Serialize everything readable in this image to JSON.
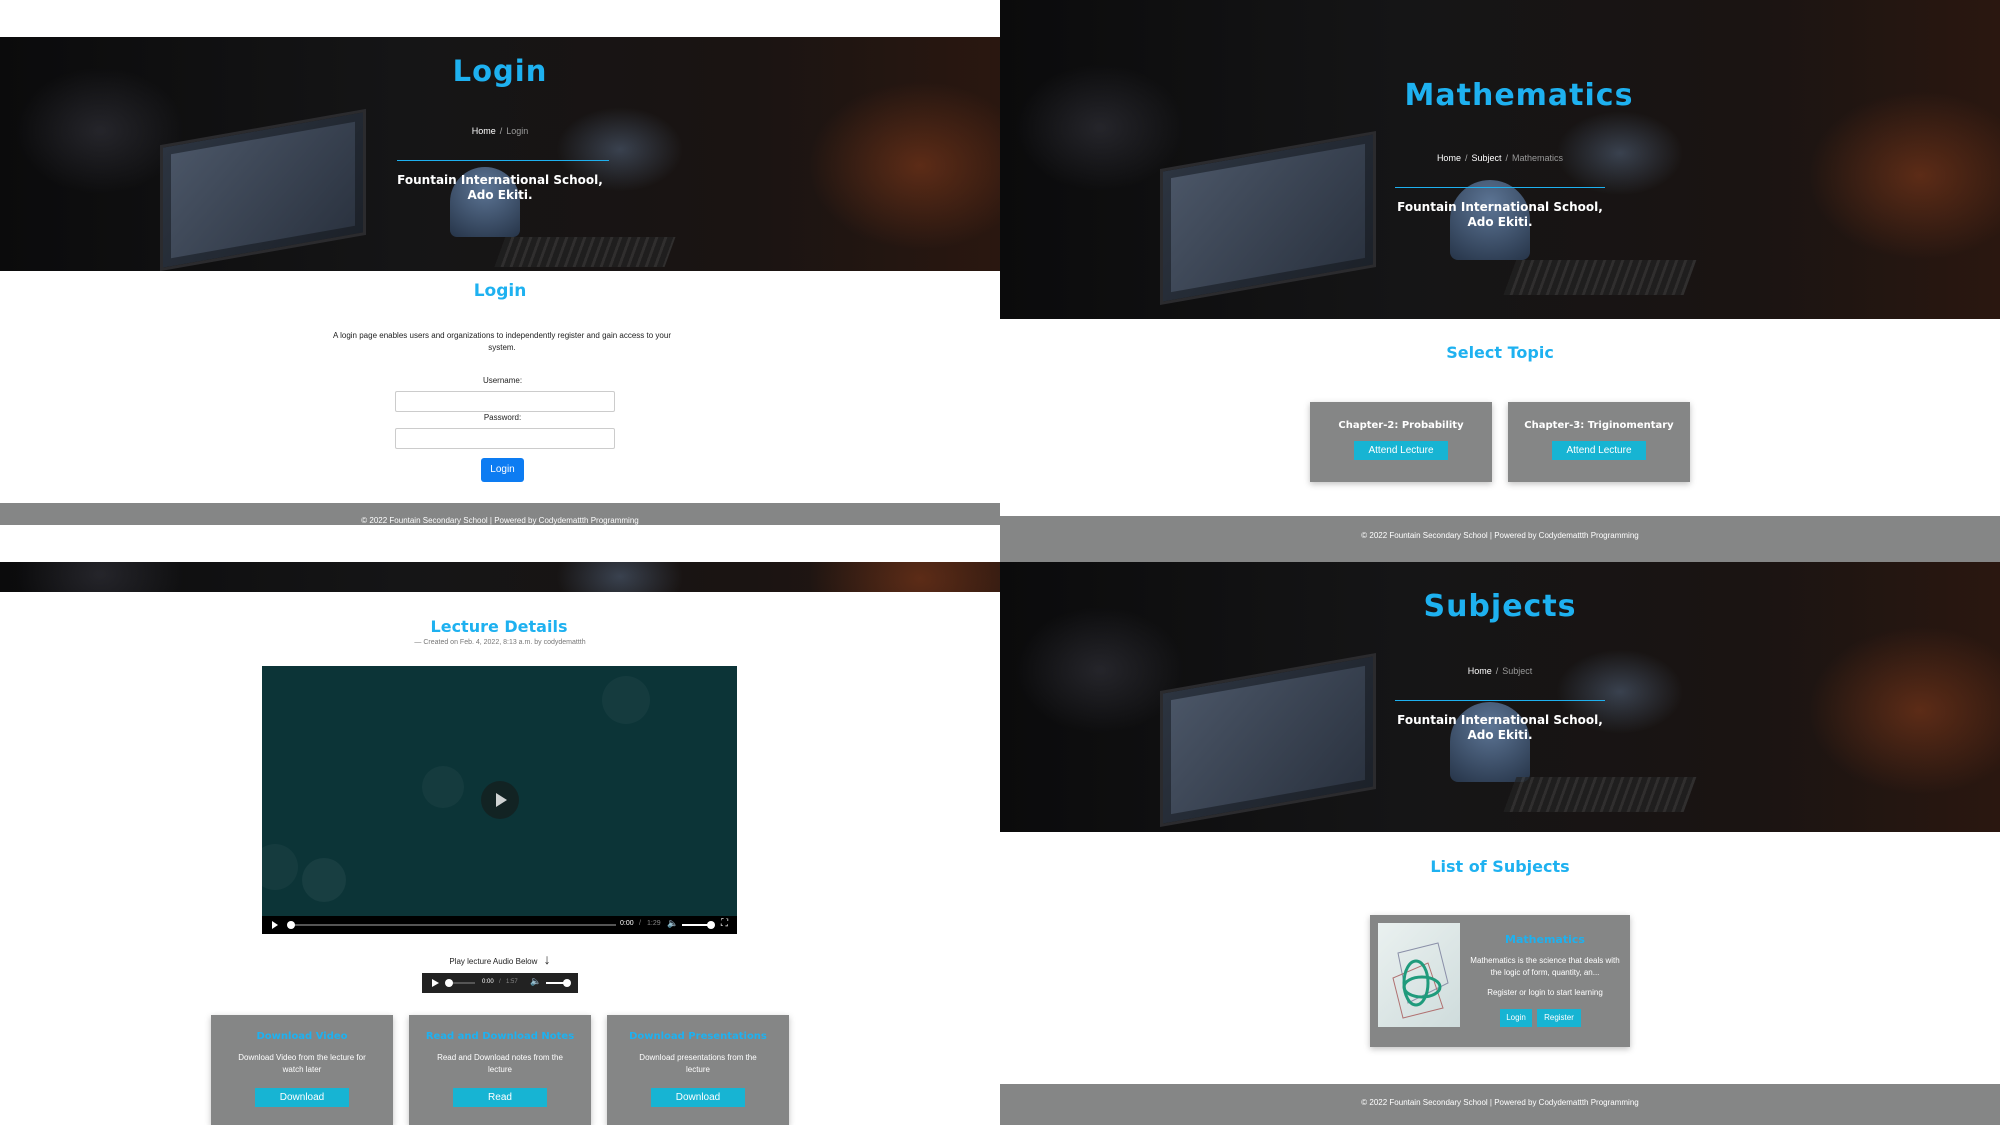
{
  "login_page": {
    "hero_title": "Login",
    "breadcrumb": {
      "home": "Home",
      "current": "Login"
    },
    "school_line1": "Fountain International School,",
    "school_line2": "Ado Ekiti.",
    "section_title": "Login",
    "description": "A login page enables users and organizations to independently register and gain access to your system.",
    "username_label": "Username:",
    "password_label": "Password:",
    "username_value": "",
    "password_value": "",
    "login_button": "Login",
    "footer": "© 2022 Fountain Secondary School | Powered by Codydemattth Programming"
  },
  "math_page": {
    "hero_title": "Mathematics",
    "breadcrumb": {
      "home": "Home",
      "middle": "Subject",
      "current": "Mathematics"
    },
    "school_line1": "Fountain International School,",
    "school_line2": "Ado Ekiti.",
    "section_title": "Select Topic",
    "topics": [
      {
        "title": "Chapter-2: Probability",
        "button": "Attend Lecture"
      },
      {
        "title": "Chapter-3: Triginomentary",
        "button": "Attend Lecture"
      }
    ],
    "footer": "© 2022 Fountain Secondary School | Powered by Codydemattth Programming"
  },
  "lecture_page": {
    "title": "Lecture Details",
    "meta": "— Created on Feb. 4, 2022, 8:13 a.m. by codydemattth",
    "video": {
      "time": "0:00",
      "duration": "1:29",
      "progress": 0.0
    },
    "audio_label": "Play lecture Audio Below",
    "audio": {
      "time": "0:00",
      "duration": "1:57",
      "progress": 0.0
    },
    "cards": [
      {
        "title": "Download Video",
        "text": "Download Video from the lecture for watch later",
        "button": "Download"
      },
      {
        "title": "Read and Download Notes",
        "text": "Read and Download notes from the lecture",
        "button": "Read"
      },
      {
        "title": "Download Presentations",
        "text": "Download presentations from the lecture",
        "button": "Download"
      }
    ]
  },
  "subjects_page": {
    "hero_title": "Subjects",
    "breadcrumb": {
      "home": "Home",
      "current": "Subject"
    },
    "school_line1": "Fountain International School,",
    "school_line2": "Ado Ekiti.",
    "section_title": "List of Subjects",
    "subject": {
      "name": "Mathematics",
      "description": "Mathematics is the science that deals with the logic of form, quantity, an...",
      "prompt": "Register or login to start learning",
      "login_button": "Login",
      "register_button": "Register"
    },
    "footer": "© 2022 Fountain Secondary School | Powered by Codydemattth Programming"
  },
  "colors": {
    "accent": "#1eb1f0",
    "button_cyan": "#17b4d3",
    "button_blue": "#0d7cf2",
    "footer_gray": "#858686",
    "card_gray": "#858686",
    "video_bg": "#0c3437"
  }
}
